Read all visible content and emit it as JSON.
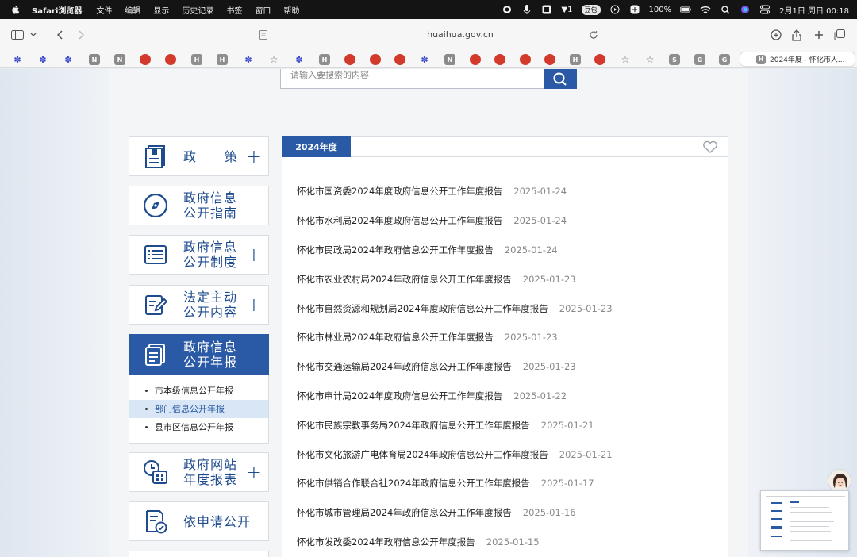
{
  "menubar": {
    "app_name": "Safari浏览器",
    "menus": [
      "文件",
      "编辑",
      "显示",
      "历史记录",
      "书签",
      "窗口",
      "帮助"
    ],
    "notification_count": "1",
    "badge_label": "豆包",
    "battery": "100%",
    "clock": "2月1日 周日  00:18"
  },
  "toolbar": {
    "url": "huaihua.gov.cn"
  },
  "favorites": {
    "letters": [
      "N",
      "N",
      "H",
      "H",
      "H",
      "N",
      "H",
      "S",
      "G",
      "G"
    ],
    "active_tab_letter": "H",
    "active_tab_title": "2024年度 - 怀化市人..."
  },
  "search": {
    "placeholder": "请输入要搜索的内容"
  },
  "sidebar": {
    "items": [
      {
        "label": "政策",
        "toggle": "+",
        "icon": "policy-book-icon"
      },
      {
        "label": "政府信息\n公开指南",
        "toggle": "",
        "icon": "compass-icon"
      },
      {
        "label": "政府信息\n公开制度",
        "toggle": "+",
        "icon": "list-document-icon"
      },
      {
        "label": "法定主动\n公开内容",
        "toggle": "+",
        "icon": "edit-document-icon"
      },
      {
        "label": "政府信息\n公开年报",
        "toggle": "−",
        "icon": "annual-report-icon"
      },
      {
        "label": "政府网站\n年度报表",
        "toggle": "+",
        "icon": "calendar-report-icon"
      },
      {
        "label": "依申请公开",
        "toggle": "",
        "icon": "apply-document-icon"
      }
    ],
    "submenu": [
      "市本级信息公开年报",
      "部门信息公开年报",
      "县市区信息公开年报"
    ]
  },
  "content": {
    "tab": "2024年度",
    "reports": [
      {
        "title": "怀化市国资委2024年度政府信息公开工作年度报告",
        "date": "2025-01-24"
      },
      {
        "title": "怀化市水利局2024年度政府信息公开工作年度报告",
        "date": "2025-01-24"
      },
      {
        "title": "怀化市民政局2024年政府信息公开工作年度报告",
        "date": "2025-01-24"
      },
      {
        "title": "怀化市农业农村局2024年政府信息公开工作年度报告",
        "date": "2025-01-23"
      },
      {
        "title": "怀化市自然资源和规划局2024年度政府信息公开工作年度报告",
        "date": "2025-01-23"
      },
      {
        "title": "怀化市林业局2024年政府信息公开工作年度报告",
        "date": "2025-01-23"
      },
      {
        "title": "怀化市交通运输局2024年政府信息公开工作年度报告",
        "date": "2025-01-23"
      },
      {
        "title": "怀化市审计局2024年度政府信息公开工作年度报告",
        "date": "2025-01-22"
      },
      {
        "title": "怀化市民族宗教事务局2024年政府信息公开工作年度报告",
        "date": "2025-01-21"
      },
      {
        "title": "怀化市文化旅游广电体育局2024年政府信息公开工作年度报告",
        "date": "2025-01-21"
      },
      {
        "title": "怀化市供销合作联合社2024年政府信息公开工作年度报告",
        "date": "2025-01-17"
      },
      {
        "title": "怀化市城市管理局2024年政府信息公开工作年度报告",
        "date": "2025-01-16"
      },
      {
        "title": "怀化市发改委2024年政府信息公开年度报告",
        "date": "2025-01-15"
      }
    ]
  },
  "colors": {
    "accent": "#2a5aa5",
    "text_blue": "#1e4b8e",
    "submenu_highlight": "#d8e6f5"
  }
}
